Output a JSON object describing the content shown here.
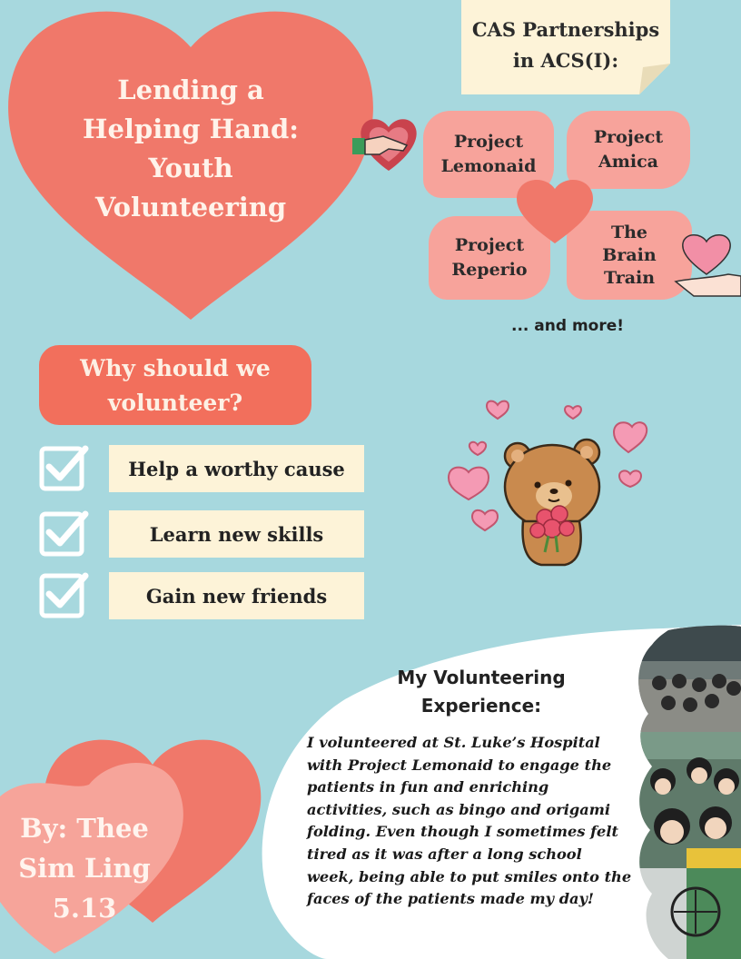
{
  "header": {
    "title_lines": [
      "Lending a",
      "Helping Hand:",
      "Youth",
      "Volunteering"
    ]
  },
  "cas": {
    "title_lines": [
      "CAS Partnerships",
      "in ACS(I):"
    ],
    "projects": [
      {
        "lines": [
          "Project",
          "Lemonaid"
        ]
      },
      {
        "lines": [
          "Project",
          "Amica"
        ]
      },
      {
        "lines": [
          "Project",
          "Reperio"
        ]
      },
      {
        "lines": [
          "The",
          "Brain",
          "Train"
        ]
      }
    ],
    "more": "... and more!"
  },
  "why": {
    "title_lines": [
      "Why should we",
      "volunteer?"
    ],
    "reasons": [
      "Help a worthy cause",
      "Learn new skills",
      "Gain new friends"
    ]
  },
  "experience": {
    "title_lines": [
      "My Volunteering",
      "Experience:"
    ],
    "body_lines": [
      "I volunteered at St. Luke’s Hospital",
      "with Project Lemonaid to engage the",
      "patients in fun and enriching",
      "activities, such as bingo and origami",
      "folding.  Even though I sometimes felt",
      "tired as it was after a long school",
      "week, being able to put smiles onto the",
      "faces of the patients made my day!"
    ]
  },
  "author": {
    "lines": [
      "By: Thee",
      "Sim Ling",
      "5.13"
    ]
  },
  "colors": {
    "background": "#a7d8de",
    "heart_coral": "#f0786a",
    "heart_pink": "#f6a49a",
    "pill_red": "#f26f5c",
    "note_cream": "#fdf3d8"
  }
}
